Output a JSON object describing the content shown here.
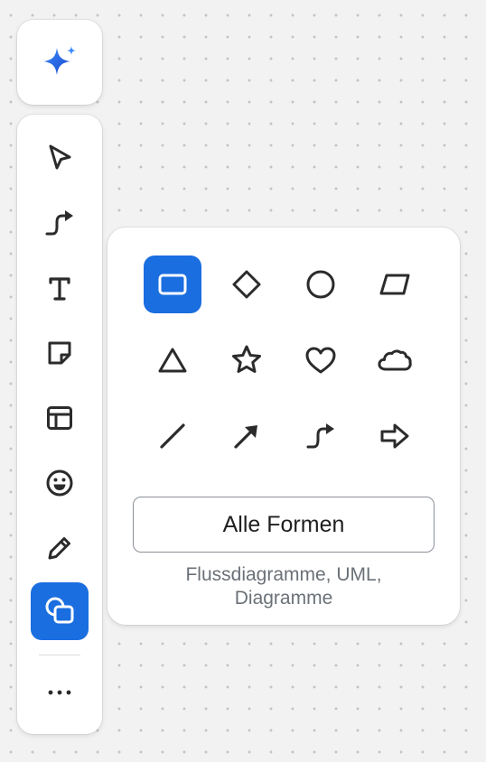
{
  "ai_button": {
    "icon": "sparkle-icon"
  },
  "toolbar": {
    "tools": [
      {
        "name": "select-tool",
        "icon": "cursor-arrow-icon"
      },
      {
        "name": "connector-tool",
        "icon": "connector-arrow-icon"
      },
      {
        "name": "text-tool",
        "icon": "text-icon"
      },
      {
        "name": "sticky-note-tool",
        "icon": "sticky-note-icon"
      },
      {
        "name": "template-tool",
        "icon": "layout-icon"
      },
      {
        "name": "emoji-tool",
        "icon": "smiley-icon"
      },
      {
        "name": "pen-tool",
        "icon": "pencil-icon"
      },
      {
        "name": "shapes-tool",
        "icon": "shapes-icon",
        "active": true
      }
    ],
    "more_icon": "more-icon"
  },
  "shapes_panel": {
    "shapes": [
      {
        "name": "rectangle",
        "icon": "rectangle-icon",
        "selected": true
      },
      {
        "name": "diamond",
        "icon": "diamond-icon"
      },
      {
        "name": "circle",
        "icon": "circle-icon"
      },
      {
        "name": "parallelogram",
        "icon": "parallelogram-icon"
      },
      {
        "name": "triangle",
        "icon": "triangle-icon"
      },
      {
        "name": "star",
        "icon": "star-icon"
      },
      {
        "name": "heart",
        "icon": "heart-icon"
      },
      {
        "name": "cloud",
        "icon": "cloud-icon"
      },
      {
        "name": "line",
        "icon": "line-icon"
      },
      {
        "name": "arrow",
        "icon": "arrow-icon"
      },
      {
        "name": "connector",
        "icon": "connector-icon"
      },
      {
        "name": "block-arrow",
        "icon": "block-arrow-icon"
      }
    ],
    "all_shapes_label": "Alle Formen",
    "hint_line1": "Flussdiagramme, UML,",
    "hint_line2": "Diagramme"
  },
  "colors": {
    "accent": "#1a6ee0",
    "icon": "#2b2b2b",
    "canvas": "#f2f2f2",
    "canvas_dot": "#c4c4c4",
    "hint_text": "#6b7178"
  }
}
